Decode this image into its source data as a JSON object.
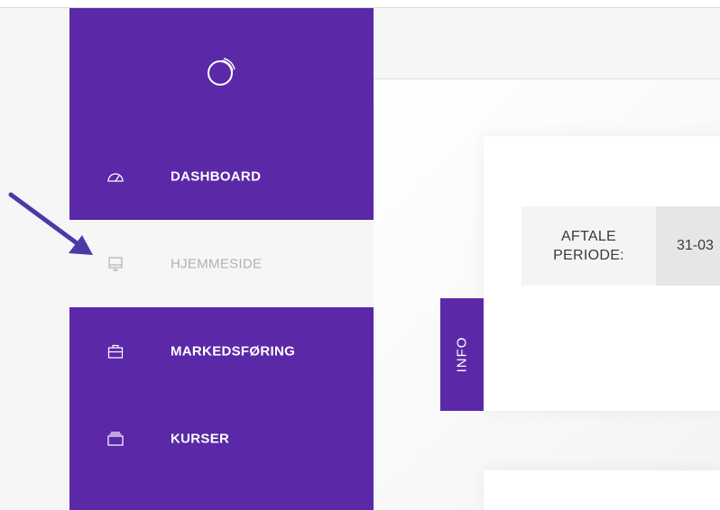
{
  "sidebar": {
    "items": [
      {
        "label": "DASHBOARD",
        "icon": "speedometer-icon",
        "active": false
      },
      {
        "label": "HJEMMESIDE",
        "icon": "monitor-icon",
        "active": true
      },
      {
        "label": "MARKEDSFØRING",
        "icon": "briefcase-icon",
        "active": false
      },
      {
        "label": "KURSER",
        "icon": "stack-icon",
        "active": false
      }
    ]
  },
  "info_tab": {
    "label": "INFO"
  },
  "agreement": {
    "period_label": "AFTALE PERIODE:",
    "period_value": "31-03"
  },
  "colors": {
    "brand": "#5b28a8",
    "arrow": "#4a3aa8",
    "background": "#f6f6f6"
  }
}
